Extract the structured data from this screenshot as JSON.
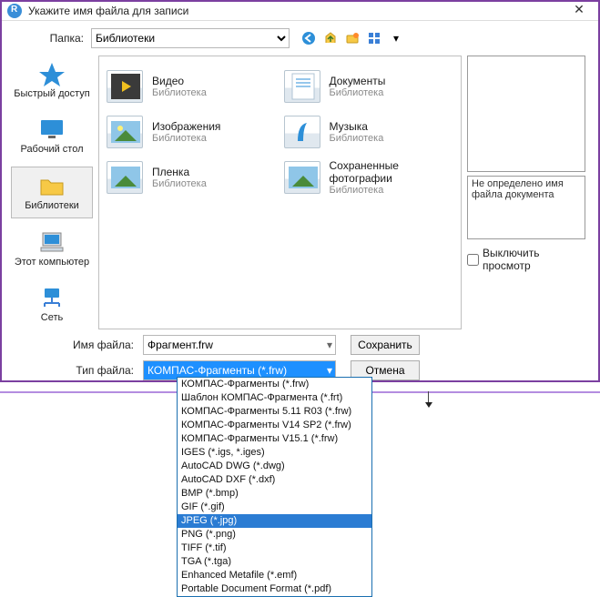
{
  "window": {
    "title": "Укажите имя файла для записи",
    "close": "✕"
  },
  "folder_row": {
    "label": "Папка:",
    "current": "Библиотеки"
  },
  "sidebar": {
    "items": [
      {
        "label": "Быстрый доступ"
      },
      {
        "label": "Рабочий стол"
      },
      {
        "label": "Библиотеки"
      },
      {
        "label": "Этот компьютер"
      },
      {
        "label": "Сеть"
      }
    ]
  },
  "libraries": {
    "sub": "Библиотека",
    "items": [
      {
        "name": "Видео"
      },
      {
        "name": "Документы"
      },
      {
        "name": "Изображения"
      },
      {
        "name": "Музыка"
      },
      {
        "name": "Пленка"
      },
      {
        "name": "Сохраненные фотографии"
      }
    ]
  },
  "preview": {
    "status": "Не определено имя файла документа",
    "checkbox_label": "Выключить просмотр"
  },
  "bottom": {
    "filename_label": "Имя файла:",
    "filename_value": "Фрагмент.frw",
    "filetype_label": "Тип файла:",
    "filetype_value": "КОМПАС-Фрагменты (*.frw)",
    "save": "Сохранить",
    "cancel": "Отмена"
  },
  "filetype_options": [
    "КОМПАС-Фрагменты (*.frw)",
    "Шаблон КОМПАС-Фрагмента (*.frt)",
    "КОМПАС-Фрагменты 5.11 R03 (*.frw)",
    "КОМПАС-Фрагменты V14 SP2 (*.frw)",
    "КОМПАС-Фрагменты V15.1 (*.frw)",
    "IGES (*.igs, *.iges)",
    "AutoCAD DWG (*.dwg)",
    "AutoCAD DXF (*.dxf)",
    "BMP (*.bmp)",
    "GIF (*.gif)",
    "JPEG (*.jpg)",
    "PNG (*.png)",
    "TIFF (*.tif)",
    "TGA (*.tga)",
    "Enhanced Metafile (*.emf)",
    "Portable Document Format (*.pdf)"
  ],
  "filetype_highlight_index": 10
}
